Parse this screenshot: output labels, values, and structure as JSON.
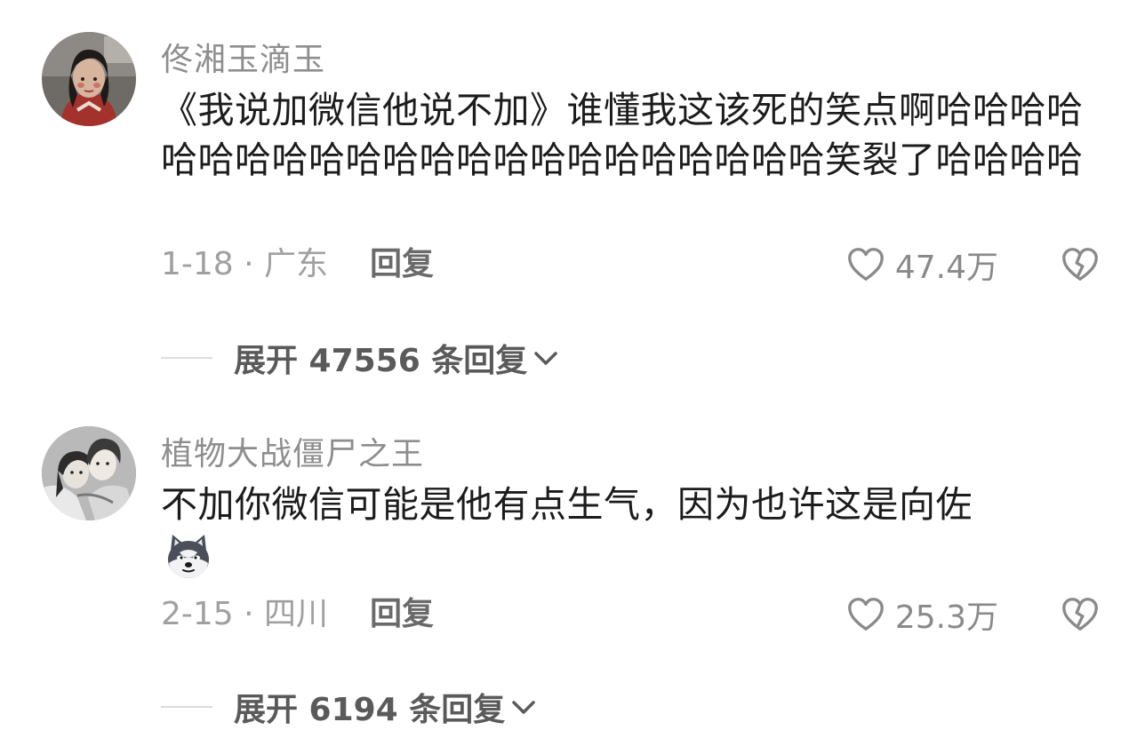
{
  "comments": [
    {
      "username": "佟湘玉滴玉",
      "content": "《我说加微信他说不加》谁懂我这该死的笑点啊哈哈哈哈哈哈哈哈哈哈哈哈哈哈哈哈哈哈哈哈哈哈笑裂了哈哈哈哈",
      "date_location": "1-18 · 广东",
      "reply_label": "回复",
      "like_count": "47.4万",
      "expand_label": "展开 47556 条回复"
    },
    {
      "username": "植物大战僵尸之王",
      "content": "不加你微信可能是他有点生气，因为也许这是向佐",
      "date_location": "2-15 · 四川",
      "reply_label": "回复",
      "like_count": "25.3万",
      "expand_label": "展开 6194 条回复"
    }
  ],
  "icons": {
    "like": "heart-outline-icon",
    "dislike": "broken-heart-icon",
    "expand": "chevron-down-icon",
    "emoji": "dog-emoji-icon"
  },
  "colors": {
    "username": "#8e8e8e",
    "content": "#1c1c1c",
    "meta": "#a0a0a0",
    "reply": "#6a6a6a",
    "expand": "#5a5a5a"
  }
}
